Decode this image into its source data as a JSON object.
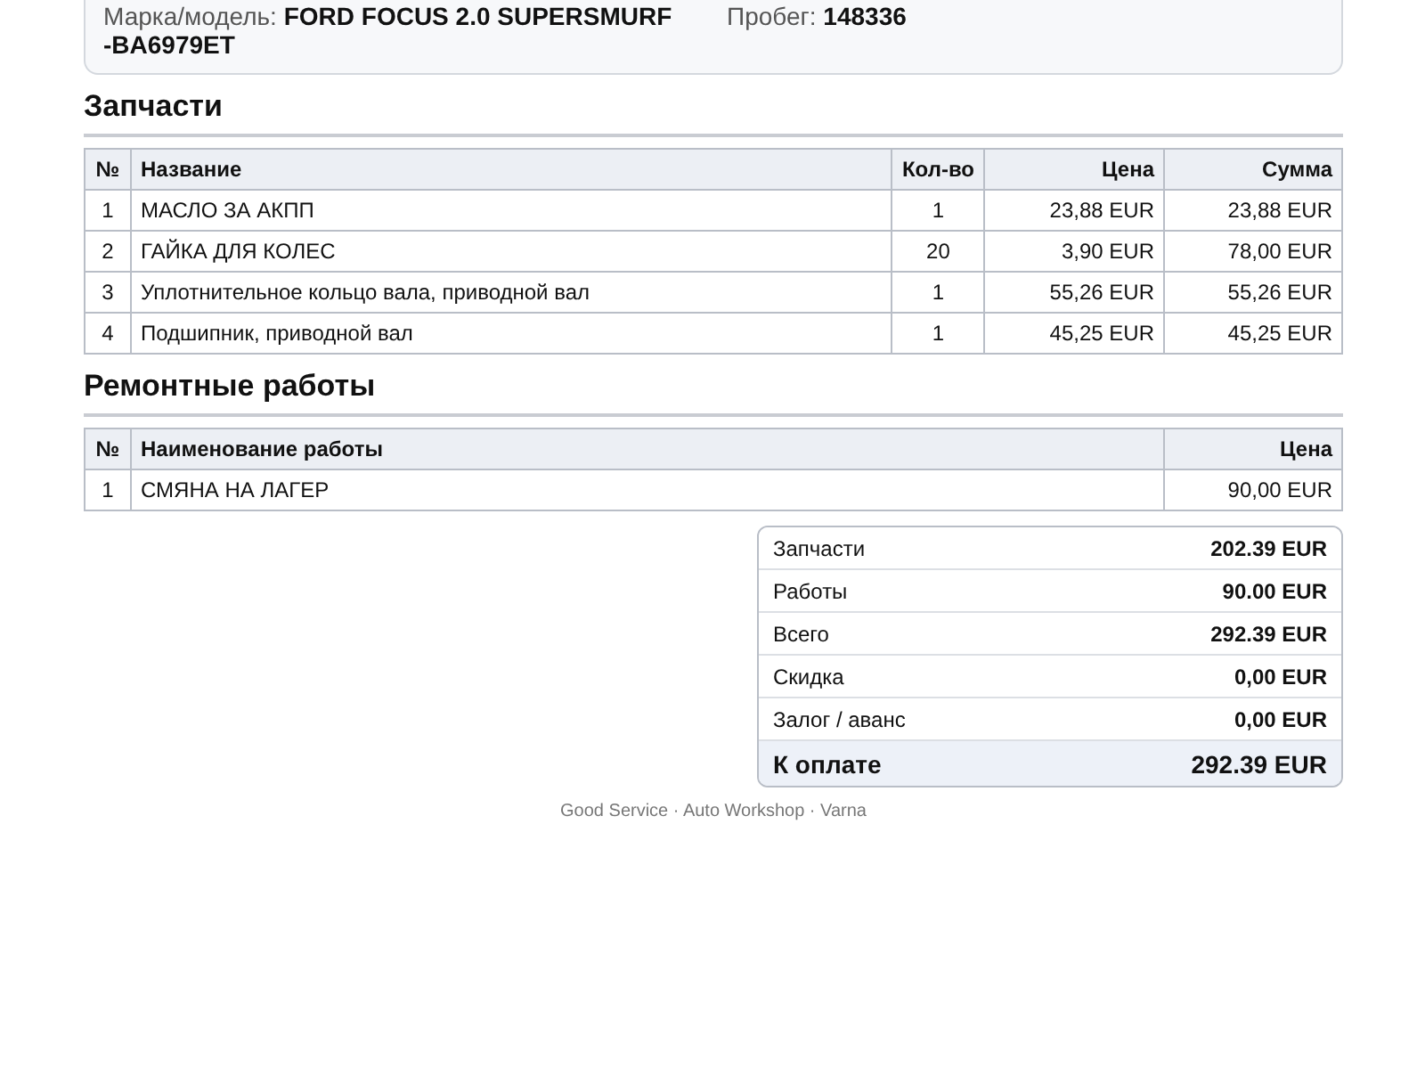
{
  "vehicle": {
    "model_label": "Марка/модель:",
    "model_value": "FORD FOCUS 2.0 SUPERSMURF",
    "plate": "-BA6979ET",
    "mileage_label": "Пробег:",
    "mileage_value": "148336"
  },
  "parts": {
    "title": "Запчасти",
    "columns": [
      "№",
      "Название",
      "Кол-во",
      "Цена",
      "Сумма"
    ],
    "rows": [
      [
        "1",
        "МАСЛО ЗА АКПП",
        "1",
        "23,88 EUR",
        "23,88 EUR"
      ],
      [
        "2",
        "ГАЙКА ДЛЯ КОЛЕС",
        "20",
        "3,90 EUR",
        "78,00 EUR"
      ],
      [
        "3",
        "Уплотнительное кольцо вала, приводной вал",
        "1",
        "55,26 EUR",
        "55,26 EUR"
      ],
      [
        "4",
        "Подшипник, приводной вал",
        "1",
        "45,25 EUR",
        "45,25 EUR"
      ]
    ]
  },
  "works": {
    "title": "Ремонтные работы",
    "columns": [
      "№",
      "Наименование работы",
      "Цена"
    ],
    "rows": [
      [
        "1",
        "СМЯНА НА ЛАГЕР",
        "90,00 EUR"
      ]
    ]
  },
  "totals": [
    {
      "label": "Запчасти",
      "value": "202.39 EUR",
      "kind": "line"
    },
    {
      "label": "Работы",
      "value": "90.00 EUR",
      "kind": "line"
    },
    {
      "label": "Всего",
      "value": "292.39 EUR",
      "kind": "line"
    },
    {
      "label": "Скидка",
      "value": "0,00 EUR",
      "kind": "line"
    },
    {
      "label": "Залог / аванс",
      "value": "0,00 EUR",
      "kind": "line"
    },
    {
      "label": "К оплате",
      "value": "292.39 EUR",
      "kind": "grand"
    }
  ],
  "footer": "Good Service · Auto Workshop · Varna"
}
